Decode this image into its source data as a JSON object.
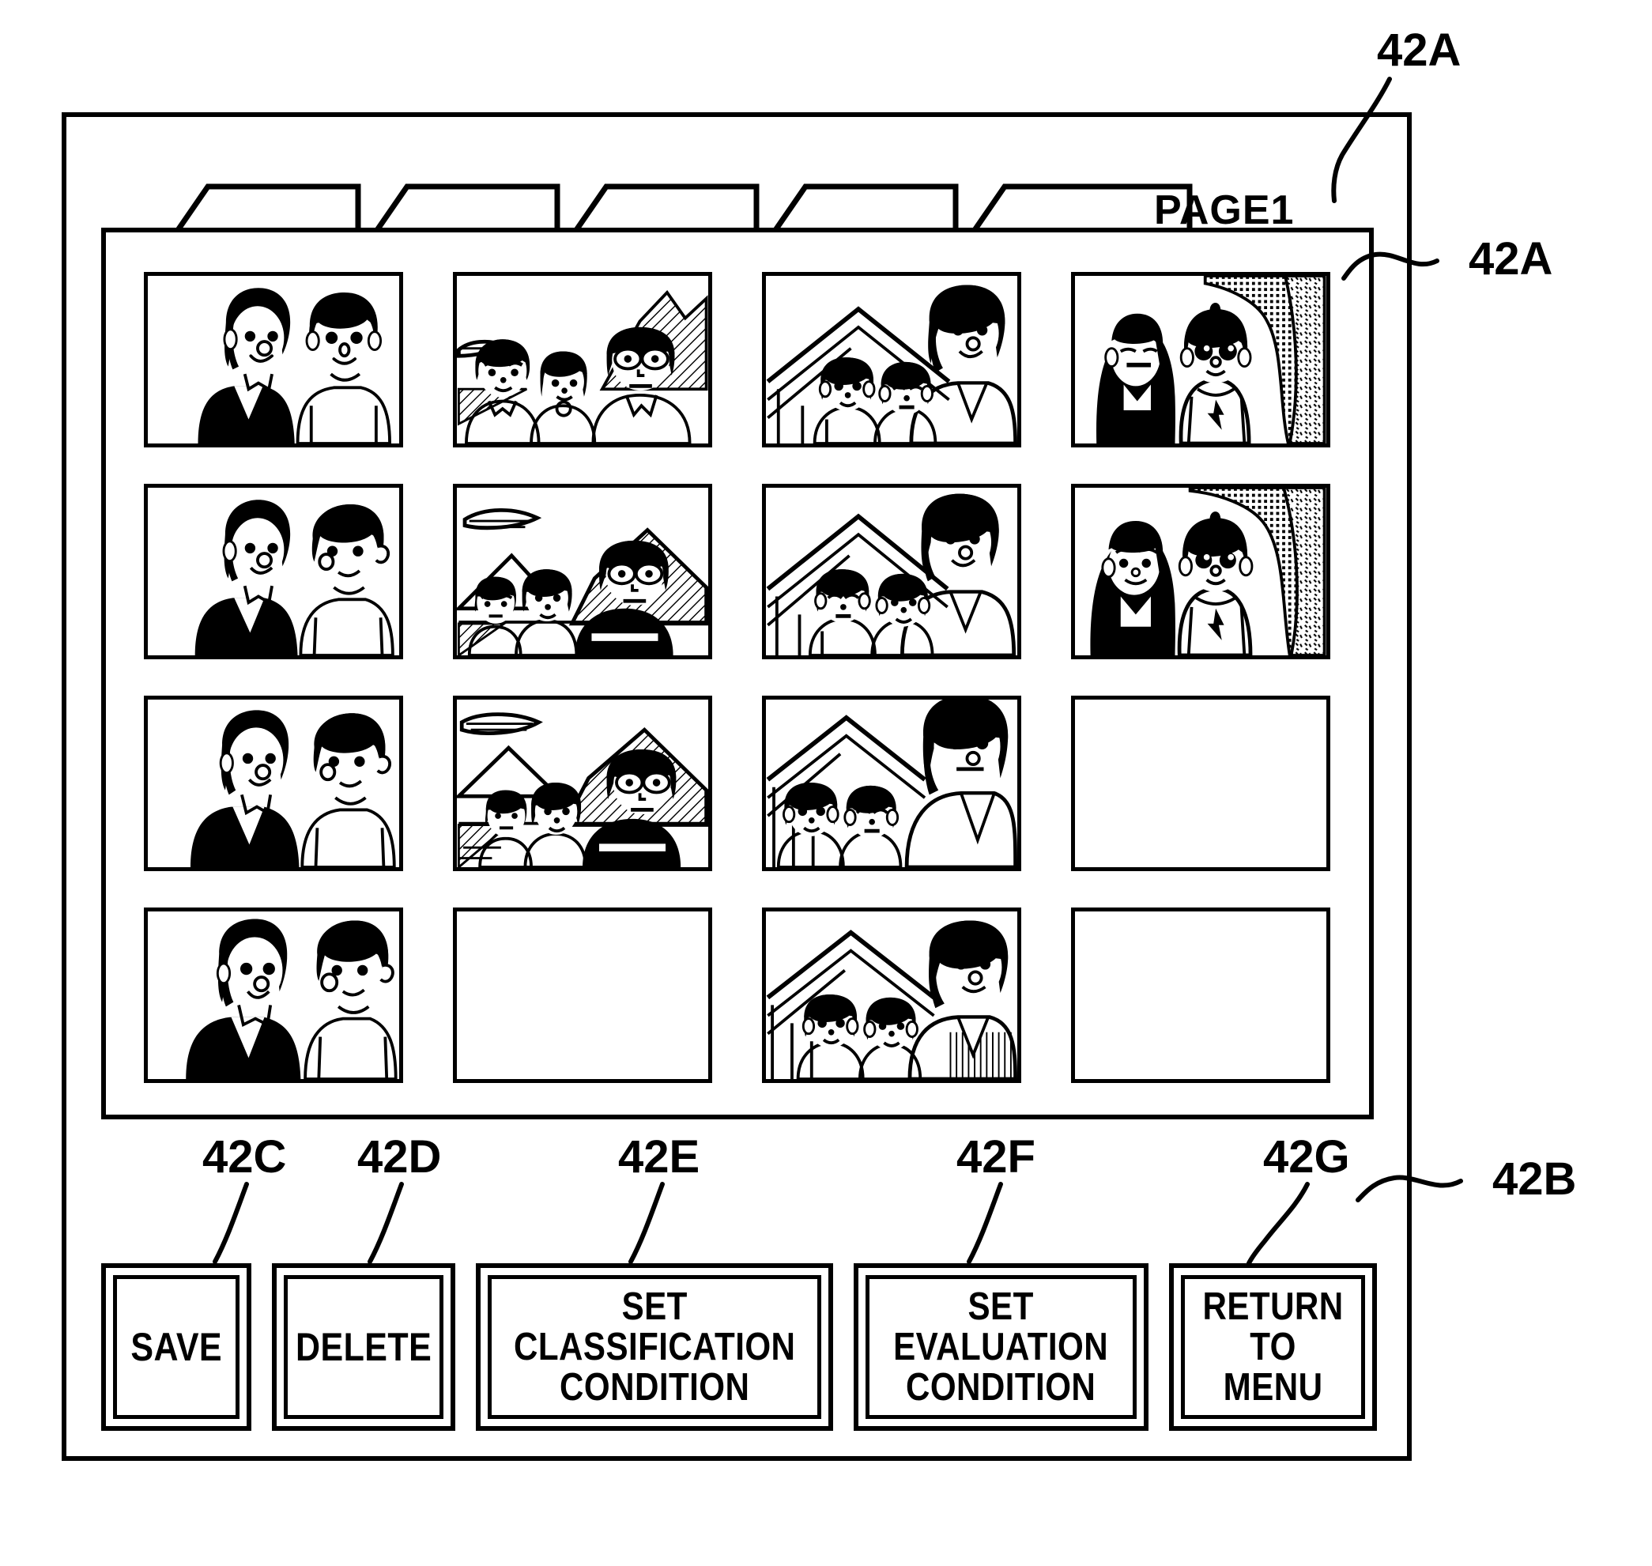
{
  "figure": {
    "reference_labels": [
      {
        "id": "42A-top",
        "text": "42A"
      },
      {
        "id": "42A-right",
        "text": "42A"
      },
      {
        "id": "42B",
        "text": "42B"
      },
      {
        "id": "42C",
        "text": "42C"
      },
      {
        "id": "42D",
        "text": "42D"
      },
      {
        "id": "42E",
        "text": "42E"
      },
      {
        "id": "42F",
        "text": "42F"
      },
      {
        "id": "42G",
        "text": "42G"
      }
    ]
  },
  "tabs": [
    {
      "label": "",
      "active": false
    },
    {
      "label": "",
      "active": false
    },
    {
      "label": "",
      "active": false
    },
    {
      "label": "",
      "active": false
    },
    {
      "label": "PAGE1",
      "active": true
    }
  ],
  "grid": {
    "columns": 4,
    "rows": 4,
    "cells": [
      {
        "index": 1,
        "kind": "photo",
        "art": "couple-woman-man",
        "empty": false
      },
      {
        "index": 2,
        "kind": "photo",
        "art": "group-three-outdoor",
        "empty": false
      },
      {
        "index": 3,
        "kind": "photo",
        "art": "family-roof-three",
        "empty": false
      },
      {
        "index": 4,
        "kind": "photo",
        "art": "two-kids-textured-bg",
        "empty": false
      },
      {
        "index": 5,
        "kind": "photo",
        "art": "couple-woman-man",
        "empty": false
      },
      {
        "index": 6,
        "kind": "photo",
        "art": "group-three-mountain",
        "empty": false
      },
      {
        "index": 7,
        "kind": "photo",
        "art": "family-roof-three-b",
        "empty": false
      },
      {
        "index": 8,
        "kind": "photo",
        "art": "two-kids-textured-bg-b",
        "empty": false
      },
      {
        "index": 9,
        "kind": "photo",
        "art": "couple-woman-man-b",
        "empty": false
      },
      {
        "index": 10,
        "kind": "photo",
        "art": "group-three-mountain-b",
        "empty": false
      },
      {
        "index": 11,
        "kind": "photo",
        "art": "family-roof-three-c",
        "empty": false
      },
      {
        "index": 12,
        "kind": "empty",
        "art": "",
        "empty": true
      },
      {
        "index": 13,
        "kind": "photo",
        "art": "couple-woman-man-c",
        "empty": false
      },
      {
        "index": 14,
        "kind": "empty",
        "art": "",
        "empty": true
      },
      {
        "index": 15,
        "kind": "photo",
        "art": "family-roof-three-d",
        "empty": false
      },
      {
        "index": 16,
        "kind": "empty",
        "art": "",
        "empty": true
      }
    ]
  },
  "buttons": [
    {
      "id": "save",
      "label": "SAVE",
      "ref": "42C"
    },
    {
      "id": "delete",
      "label": "DELETE",
      "ref": "42D"
    },
    {
      "id": "set-classification",
      "label": "SET\nCLASSIFICATION\nCONDITION",
      "ref": "42E"
    },
    {
      "id": "set-evaluation",
      "label": "SET\nEVALUATION\nCONDITION",
      "ref": "42F"
    },
    {
      "id": "return-to-menu",
      "label": "RETURN\nTO MENU",
      "ref": "42G"
    }
  ],
  "colors": {
    "ink": "#000000",
    "paper": "#ffffff"
  }
}
